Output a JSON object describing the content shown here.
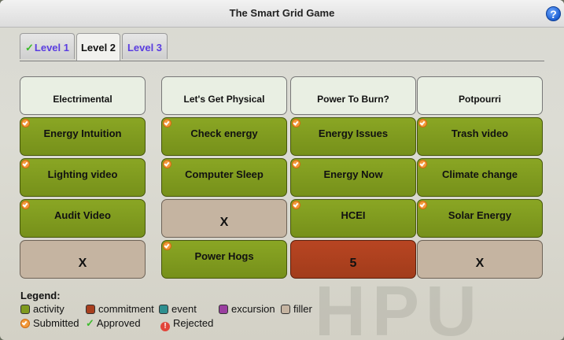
{
  "window": {
    "title": "The Smart Grid Game",
    "help_icon": "?"
  },
  "background_text": "HPU",
  "tabs": [
    {
      "label": "Level 1",
      "approved": true,
      "active": false
    },
    {
      "label": "Level 2",
      "approved": false,
      "active": true
    },
    {
      "label": "Level 3",
      "approved": false,
      "active": false
    }
  ],
  "columns": [
    "Electrimental",
    "Let's Get Physical",
    "Power To Burn?",
    "Potpourri"
  ],
  "grid": [
    [
      {
        "label": "Energy Intuition",
        "type": "activity",
        "submitted": true
      },
      {
        "label": "Check energy",
        "type": "activity",
        "submitted": true
      },
      {
        "label": "Energy Issues",
        "type": "activity",
        "submitted": true
      },
      {
        "label": "Trash video",
        "type": "activity",
        "submitted": true
      }
    ],
    [
      {
        "label": "Lighting video",
        "type": "activity",
        "submitted": true
      },
      {
        "label": "Computer Sleep",
        "type": "activity",
        "submitted": true
      },
      {
        "label": "Energy Now",
        "type": "activity",
        "submitted": true
      },
      {
        "label": "Climate change",
        "type": "activity",
        "submitted": true
      }
    ],
    [
      {
        "label": "Audit Video",
        "type": "activity",
        "submitted": true
      },
      {
        "label": "X",
        "type": "filler",
        "submitted": false
      },
      {
        "label": "HCEI",
        "type": "activity",
        "submitted": true
      },
      {
        "label": "Solar Energy",
        "type": "activity",
        "submitted": true
      }
    ],
    [
      {
        "label": "X",
        "type": "filler",
        "submitted": false
      },
      {
        "label": "Power Hogs",
        "type": "activity",
        "submitted": true
      },
      {
        "label": "5",
        "type": "commitment",
        "submitted": false
      },
      {
        "label": "X",
        "type": "filler",
        "submitted": false
      }
    ]
  ],
  "legend": {
    "title": "Legend:",
    "types": [
      {
        "label": "activity",
        "color": "#7f9a1e"
      },
      {
        "label": "commitment",
        "color": "#a83f1e"
      },
      {
        "label": "event",
        "color": "#2e8f8f"
      },
      {
        "label": "excursion",
        "color": "#9a3fa0"
      },
      {
        "label": "filler",
        "color": "#c5b4a1"
      }
    ],
    "statuses": {
      "submitted": "Submitted",
      "approved": "Approved",
      "rejected": "Rejected"
    }
  }
}
